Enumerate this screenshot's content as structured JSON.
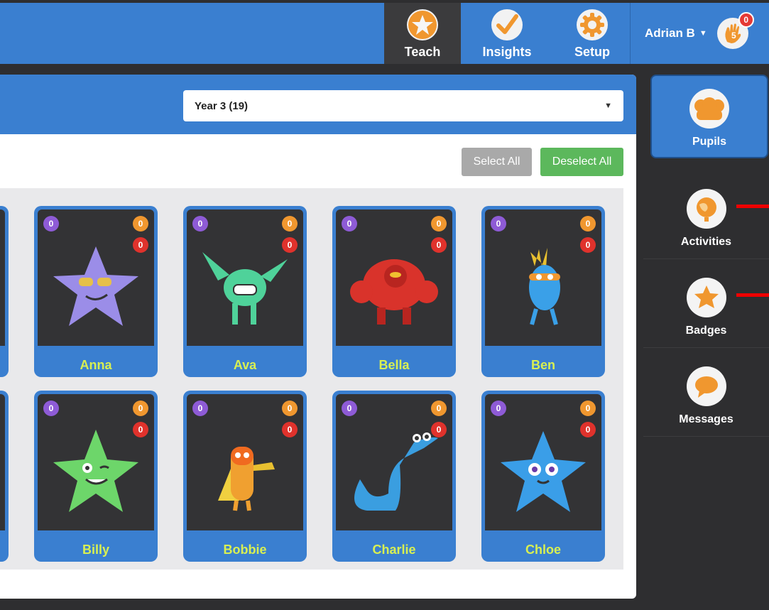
{
  "header": {
    "nav": [
      {
        "label": "Teach",
        "icon": "star-icon",
        "active": true
      },
      {
        "label": "Insights",
        "icon": "check-icon",
        "active": false
      },
      {
        "label": "Setup",
        "icon": "gear-icon",
        "active": false
      }
    ],
    "user": {
      "name": "Adrian B",
      "notifications": "0",
      "hand_badge": "5"
    }
  },
  "class_select": {
    "value": "Year 3 (19)"
  },
  "buttons": {
    "select_all": "Select All",
    "deselect_all": "Deselect All"
  },
  "pupils": [
    {
      "name": "Anna",
      "purple": "0",
      "orange": "0",
      "red": "0",
      "avatar": "star-sunglasses"
    },
    {
      "name": "Ava",
      "purple": "0",
      "orange": "0",
      "red": "0",
      "avatar": "green-goblin"
    },
    {
      "name": "Bella",
      "purple": "0",
      "orange": "0",
      "red": "0",
      "avatar": "red-robot"
    },
    {
      "name": "Ben",
      "purple": "0",
      "orange": "0",
      "red": "0",
      "avatar": "blue-feather-monster"
    },
    {
      "name": "Billy",
      "purple": "0",
      "orange": "0",
      "red": "0",
      "avatar": "green-star-wink"
    },
    {
      "name": "Bobbie",
      "purple": "0",
      "orange": "0",
      "red": "0",
      "avatar": "orange-trumpet-monster"
    },
    {
      "name": "Charlie",
      "purple": "0",
      "orange": "0",
      "red": "0",
      "avatar": "blue-dinosaur"
    },
    {
      "name": "Chloe",
      "purple": "0",
      "orange": "0",
      "red": "0",
      "avatar": "blue-star"
    }
  ],
  "sidebar": {
    "items": [
      {
        "label": "Pupils",
        "icon": "pupils-icon",
        "active": true
      },
      {
        "label": "Activities",
        "icon": "globe-icon",
        "active": false
      },
      {
        "label": "Badges",
        "icon": "badge-icon",
        "active": false
      },
      {
        "label": "Messages",
        "icon": "speech-bubble-icon",
        "active": false
      }
    ]
  },
  "colors": {
    "brand_blue": "#3a7fd0",
    "name_text": "#d8ef52",
    "badge_purple": "#8e5bd6",
    "badge_orange": "#f0972f",
    "badge_red": "#e0322c",
    "deselect_green": "#5cb85c"
  }
}
